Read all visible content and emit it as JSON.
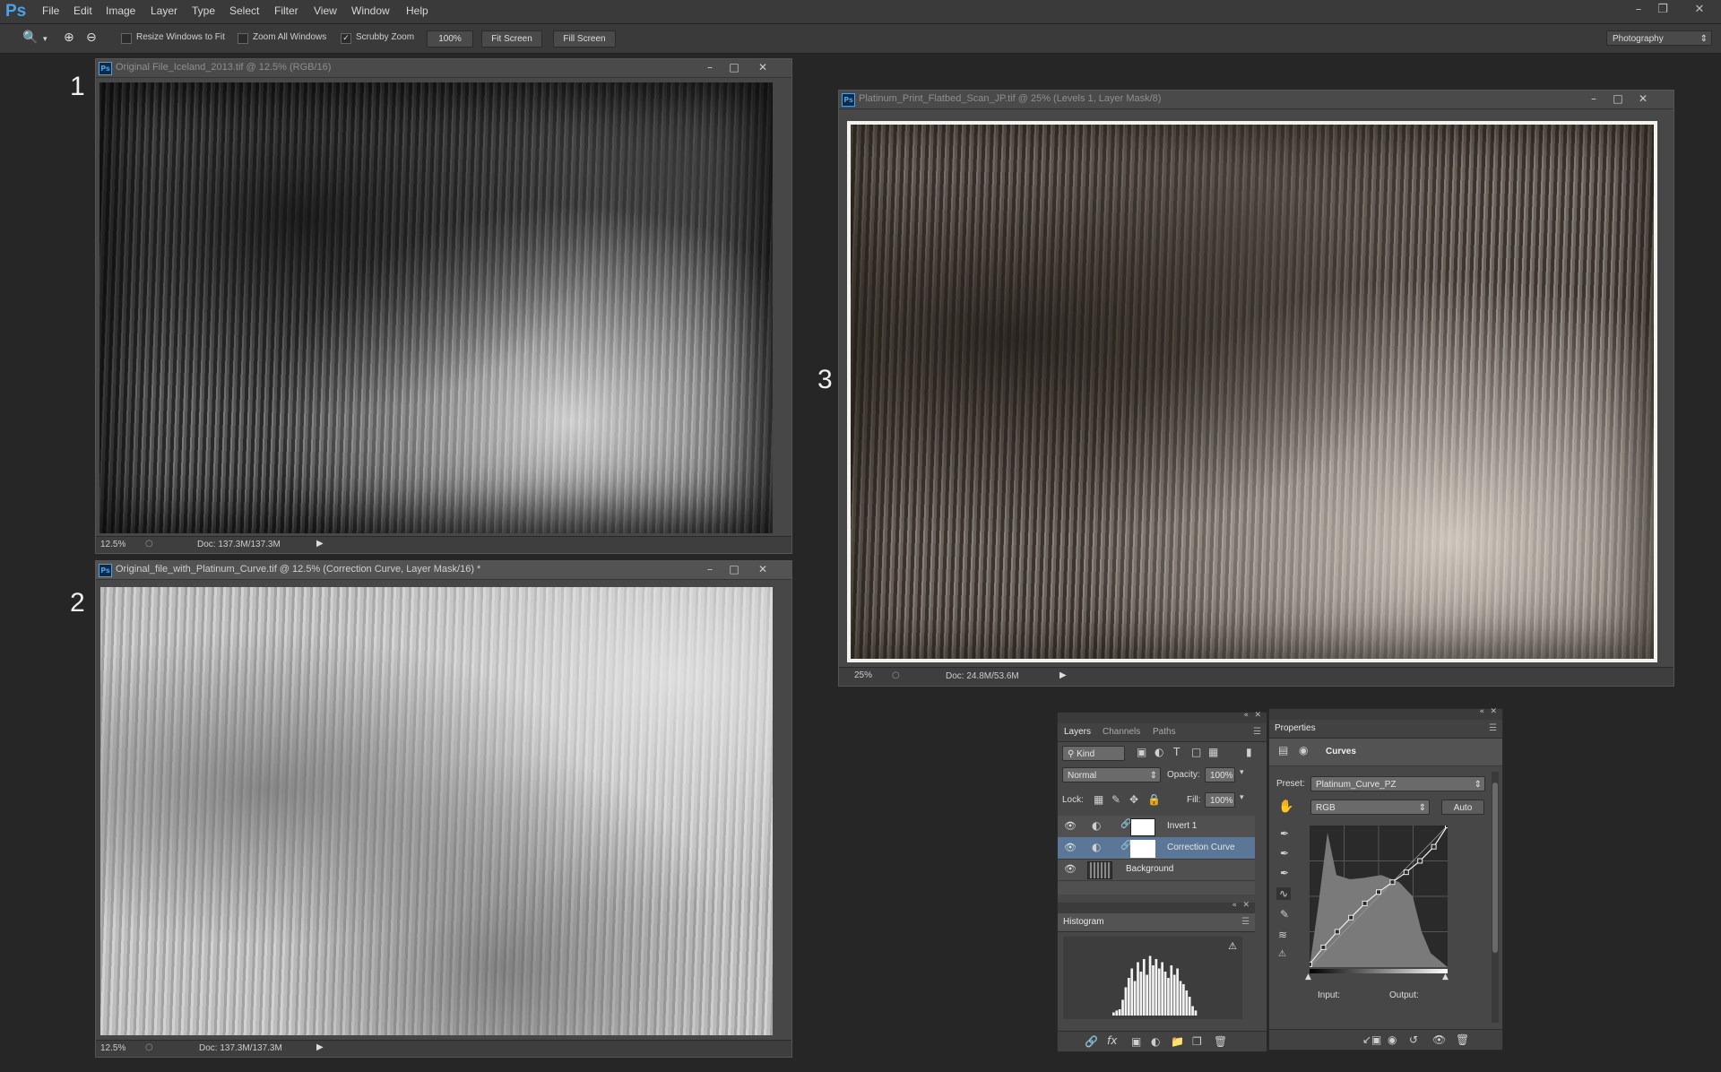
{
  "app": {
    "logo": "Ps"
  },
  "menu": [
    "File",
    "Edit",
    "Image",
    "Layer",
    "Type",
    "Select",
    "Filter",
    "View",
    "Window",
    "Help"
  ],
  "options_bar": {
    "resize_windows": "Resize Windows to Fit",
    "zoom_all": "Zoom All Windows",
    "scrubby_zoom": "Scrubby Zoom",
    "btn_100": "100%",
    "btn_fit": "Fit Screen",
    "btn_fill": "Fill Screen",
    "workspace": "Photography"
  },
  "labels": {
    "one": "1",
    "two": "2",
    "three": "3"
  },
  "doc1": {
    "title": "Original File_Iceland_2013.tif @ 12.5% (RGB/16)",
    "zoom": "12.5%",
    "doc": "Doc: 137.3M/137.3M"
  },
  "doc2": {
    "title": "Original_file_with_Platinum_Curve.tif @ 12.5% (Correction Curve, Layer Mask/16) *",
    "zoom": "12.5%",
    "doc": "Doc: 137.3M/137.3M"
  },
  "doc3": {
    "title": "Platinum_Print_Flatbed_Scan_JP.tif @ 25% (Levels 1, Layer Mask/8)",
    "zoom": "25%",
    "doc": "Doc: 24.8M/53.6M"
  },
  "layers_panel": {
    "tabs": [
      "Layers",
      "Channels",
      "Paths"
    ],
    "kind": "Kind",
    "blend": "Normal",
    "opacity_label": "Opacity:",
    "opacity": "100%",
    "lock_label": "Lock:",
    "fill_label": "Fill:",
    "fill": "100%",
    "layers": [
      "Invert 1",
      "Correction Curve",
      "Background"
    ]
  },
  "histogram_panel": {
    "tab": "Histogram",
    "bars": [
      0.05,
      0.08,
      0.1,
      0.25,
      0.45,
      0.6,
      0.75,
      0.55,
      0.85,
      0.7,
      0.9,
      0.65,
      0.95,
      0.8,
      0.9,
      0.75,
      0.85,
      0.7,
      0.6,
      0.8,
      0.65,
      0.75,
      0.55,
      0.5,
      0.4,
      0.3,
      0.15,
      0.08
    ]
  },
  "properties_panel": {
    "tab": "Properties",
    "title": "Curves",
    "preset_label": "Preset:",
    "preset": "Platinum_Curve_PZ",
    "channel": "RGB",
    "auto": "Auto",
    "input_label": "Input:",
    "output_label": "Output:",
    "curve_points": [
      [
        0,
        0.02
      ],
      [
        0.1,
        0.14
      ],
      [
        0.2,
        0.25
      ],
      [
        0.3,
        0.35
      ],
      [
        0.4,
        0.45
      ],
      [
        0.5,
        0.53
      ],
      [
        0.6,
        0.6
      ],
      [
        0.7,
        0.67
      ],
      [
        0.8,
        0.75
      ],
      [
        0.9,
        0.85
      ],
      [
        1,
        1
      ]
    ]
  },
  "colors": {
    "accent": "#4aa3e8",
    "selected_layer": "#5b7696",
    "bg": "#262626"
  }
}
